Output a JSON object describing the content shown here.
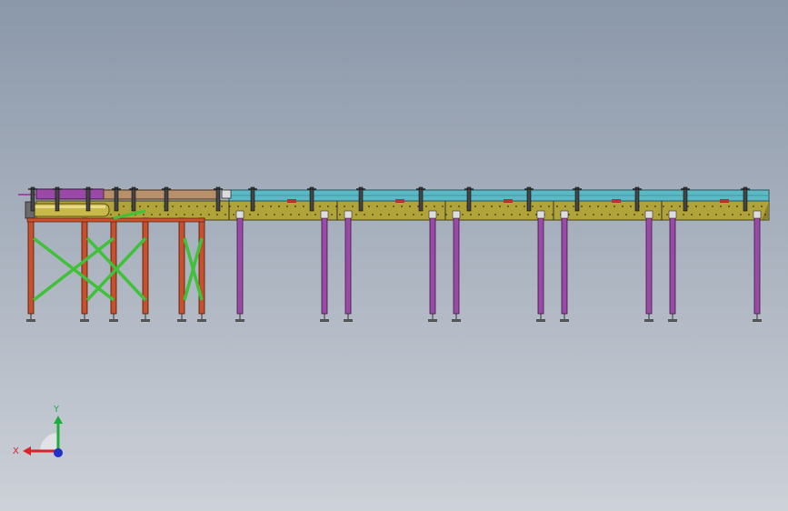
{
  "viewport": {
    "background_top": "#8b98aa",
    "background_bottom": "#cdd1d8"
  },
  "model": {
    "frame_color": "#b0a33a",
    "rail_color": "#5bb9c6",
    "purple_rail_color": "#9a4aa6",
    "tan_rail_color": "#b8916a",
    "leg_purple_color": "#9a4aa6",
    "leg_orange_color": "#c8502c",
    "brace_green_color": "#3fc23a",
    "roller_color": "#c9b84a"
  },
  "triad": {
    "x_label": "X",
    "y_label": "Y",
    "x_color": "#d6262a",
    "y_color": "#1fae3c",
    "z_color": "#2030c8",
    "x_icon": "x-axis-arrow-icon",
    "y_icon": "y-axis-arrow-icon",
    "z_icon": "z-axis-dot-icon"
  }
}
